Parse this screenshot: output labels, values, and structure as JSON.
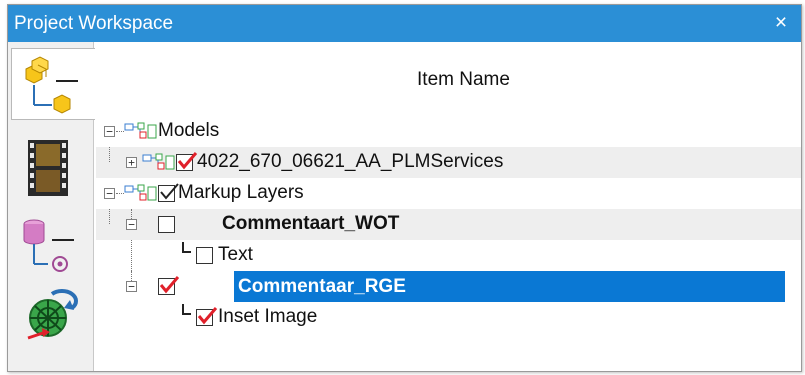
{
  "window": {
    "title": "Project Workspace",
    "close_symbol": "×"
  },
  "sidebar": {
    "items": [
      {
        "icon": "model-tree-icon",
        "active": true
      },
      {
        "icon": "film-strip-icon",
        "active": false
      },
      {
        "icon": "database-tree-icon",
        "active": false
      },
      {
        "icon": "globe-network-icon",
        "active": false
      }
    ]
  },
  "tree": {
    "column_header": "Item Name",
    "rows": [
      {
        "label": "Models",
        "level": 0,
        "expander": "minus",
        "checkbox": "none",
        "bold": false,
        "selected": false
      },
      {
        "label": "4022_670_06621_AA_PLMServices",
        "level": 1,
        "expander": "plus",
        "checkbox": "red-check",
        "bold": false,
        "selected": false
      },
      {
        "label": "Markup Layers",
        "level": 0,
        "expander": "minus",
        "checkbox": "black-check",
        "bold": false,
        "selected": false
      },
      {
        "label": "Commentaart_WOT",
        "level": 1,
        "expander": "minus",
        "checkbox": "unchecked",
        "bold": true,
        "selected": false
      },
      {
        "label": "Text",
        "level": 2,
        "expander": "none",
        "checkbox": "unchecked",
        "bold": false,
        "selected": false
      },
      {
        "label": "Commentaar_RGE",
        "level": 1,
        "expander": "minus",
        "checkbox": "red-check",
        "bold": true,
        "selected": true
      },
      {
        "label": "Inset Image",
        "level": 2,
        "expander": "none",
        "checkbox": "red-check",
        "bold": false,
        "selected": false
      }
    ]
  },
  "colors": {
    "titlebar": "#2b8fd6",
    "selection": "#0a78d4",
    "check_red": "#e0202a"
  }
}
